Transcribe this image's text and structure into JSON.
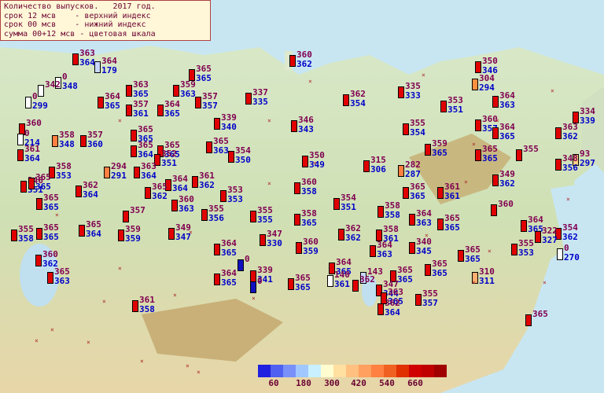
{
  "legend": {
    "lines": [
      "Количество выпусков.   2017 год.",
      "срок 12 мсв    - верхний индекс",
      "срок 00 мсв    - нижний индекс",
      "сумма 00+12 мсв - цветовая шкала"
    ]
  },
  "color_scale": {
    "colors": [
      "#2020e0",
      "#5060f0",
      "#7890f8",
      "#a0c8ff",
      "#c8f0ff",
      "#fffcd0",
      "#ffe0a0",
      "#ffc080",
      "#ffa060",
      "#ff8040",
      "#f06020",
      "#e03000",
      "#d00000",
      "#c00000",
      "#a00000"
    ],
    "ticks": [
      "60",
      "180",
      "300",
      "420",
      "540",
      "660"
    ]
  },
  "stations": [
    {
      "upper": "363",
      "lower": "364",
      "color": "#e00000"
    },
    {
      "upper": "364",
      "lower": "179",
      "color": "#c8d8ff"
    },
    {
      "upper": "365",
      "lower": "365",
      "color": "#e00000"
    },
    {
      "upper": "360",
      "lower": "362",
      "color": "#e00000"
    },
    {
      "upper": "350",
      "lower": "346",
      "color": "#e00000"
    },
    {
      "upper": "304",
      "lower": "294",
      "color": "#ff9040"
    },
    {
      "upper": "0",
      "lower": "348",
      "color": "#ffffff"
    },
    {
      "upper": "342",
      "lower": "",
      "color": "#ffffff"
    },
    {
      "upper": "0",
      "lower": "299",
      "color": "#ffffff"
    },
    {
      "upper": "363",
      "lower": "365",
      "color": "#e00000"
    },
    {
      "upper": "359",
      "lower": "363",
      "color": "#e00000"
    },
    {
      "upper": "337",
      "lower": "335",
      "color": "#e00000"
    },
    {
      "upper": "362",
      "lower": "354",
      "color": "#e00000"
    },
    {
      "upper": "335",
      "lower": "333",
      "color": "#e00000"
    },
    {
      "upper": "353",
      "lower": "351",
      "color": "#e00000"
    },
    {
      "upper": "364",
      "lower": "363",
      "color": "#e00000"
    },
    {
      "upper": "334",
      "lower": "339",
      "color": "#e00000"
    },
    {
      "upper": "364",
      "lower": "365",
      "color": "#e00000"
    },
    {
      "upper": "357",
      "lower": "361",
      "color": "#e00000"
    },
    {
      "upper": "364",
      "lower": "365",
      "color": "#e00000"
    },
    {
      "upper": "357",
      "lower": "357",
      "color": "#e00000"
    },
    {
      "upper": "339",
      "lower": "340",
      "color": "#e00000"
    },
    {
      "upper": "346",
      "lower": "343",
      "color": "#e00000"
    },
    {
      "upper": "355",
      "lower": "354",
      "color": "#e00000"
    },
    {
      "upper": "360",
      "lower": "357",
      "color": "#e00000"
    },
    {
      "upper": "364",
      "lower": "365",
      "color": "#e00000"
    },
    {
      "upper": "363",
      "lower": "362",
      "color": "#e00000"
    },
    {
      "upper": "360",
      "lower": "",
      "color": "#e00000"
    },
    {
      "upper": "0",
      "lower": "214",
      "color": "#ffffff"
    },
    {
      "upper": "358",
      "lower": "348",
      "color": "#ff8040"
    },
    {
      "upper": "357",
      "lower": "360",
      "color": "#e00000"
    },
    {
      "upper": "365",
      "lower": "365",
      "color": "#e00000"
    },
    {
      "upper": "365",
      "lower": "365",
      "color": "#e00000"
    },
    {
      "upper": "365",
      "lower": "363",
      "color": "#e00000"
    },
    {
      "upper": "354",
      "lower": "350",
      "color": "#e00000"
    },
    {
      "upper": "359",
      "lower": "365",
      "color": "#e00000"
    },
    {
      "upper": "365",
      "lower": "365",
      "color": "#e00000"
    },
    {
      "upper": "355",
      "lower": "",
      "color": "#e00000"
    },
    {
      "upper": "93",
      "lower": "297",
      "color": "#ffd080"
    },
    {
      "upper": "361",
      "lower": "364",
      "color": "#e00000"
    },
    {
      "upper": "365",
      "lower": "364",
      "color": "#e00000"
    },
    {
      "upper": "352",
      "lower": "351",
      "color": "#e00000"
    },
    {
      "upper": "350",
      "lower": "349",
      "color": "#e00000"
    },
    {
      "upper": "315",
      "lower": "306",
      "color": "#e00000"
    },
    {
      "upper": "282",
      "lower": "287",
      "color": "#ff8040"
    },
    {
      "upper": "348",
      "lower": "356",
      "color": "#e00000"
    },
    {
      "upper": "358",
      "lower": "353",
      "color": "#e00000"
    },
    {
      "upper": "294",
      "lower": "291",
      "color": "#ff8040"
    },
    {
      "upper": "363",
      "lower": "364",
      "color": "#e00000"
    },
    {
      "upper": "346",
      "lower": "351",
      "color": "#e00000"
    },
    {
      "upper": "365",
      "lower": "365",
      "color": "#e00000"
    },
    {
      "upper": "362",
      "lower": "364",
      "color": "#e00000"
    },
    {
      "upper": "364",
      "lower": "364",
      "color": "#e00000"
    },
    {
      "upper": "361",
      "lower": "362",
      "color": "#e00000"
    },
    {
      "upper": "360",
      "lower": "358",
      "color": "#e00000"
    },
    {
      "upper": "365",
      "lower": "365",
      "color": "#e00000"
    },
    {
      "upper": "361",
      "lower": "361",
      "color": "#e00000"
    },
    {
      "upper": "349",
      "lower": "362",
      "color": "#e00000"
    },
    {
      "upper": "365",
      "lower": "365",
      "color": "#e00000"
    },
    {
      "upper": "365",
      "lower": "362",
      "color": "#e00000"
    },
    {
      "upper": "353",
      "lower": "353",
      "color": "#e00000"
    },
    {
      "upper": "354",
      "lower": "351",
      "color": "#e00000"
    },
    {
      "upper": "358",
      "lower": "358",
      "color": "#e00000"
    },
    {
      "upper": "364",
      "lower": "363",
      "color": "#e00000"
    },
    {
      "upper": "365",
      "lower": "365",
      "color": "#e00000"
    },
    {
      "upper": "360",
      "lower": "",
      "color": "#e00000"
    },
    {
      "upper": "364",
      "lower": "365",
      "color": "#e00000"
    },
    {
      "upper": "357",
      "lower": "",
      "color": "#e00000"
    },
    {
      "upper": "360",
      "lower": "363",
      "color": "#e00000"
    },
    {
      "upper": "355",
      "lower": "356",
      "color": "#e00000"
    },
    {
      "upper": "355",
      "lower": "355",
      "color": "#e00000"
    },
    {
      "upper": "358",
      "lower": "365",
      "color": "#e00000"
    },
    {
      "upper": "354",
      "lower": "362",
      "color": "#e00000"
    },
    {
      "upper": "322",
      "lower": "327",
      "color": "#e00000"
    },
    {
      "upper": "0",
      "lower": "270",
      "color": "#ffffff"
    },
    {
      "upper": "355",
      "lower": "358",
      "color": "#e00000"
    },
    {
      "upper": "365",
      "lower": "365",
      "color": "#e00000"
    },
    {
      "upper": "365",
      "lower": "364",
      "color": "#e00000"
    },
    {
      "upper": "359",
      "lower": "359",
      "color": "#e00000"
    },
    {
      "upper": "349",
      "lower": "347",
      "color": "#e00000"
    },
    {
      "upper": "347",
      "lower": "330",
      "color": "#e00000"
    },
    {
      "upper": "362",
      "lower": "362",
      "color": "#e00000"
    },
    {
      "upper": "358",
      "lower": "361",
      "color": "#e00000"
    },
    {
      "upper": "340",
      "lower": "345",
      "color": "#e00000"
    },
    {
      "upper": "365",
      "lower": "365",
      "color": "#e00000"
    },
    {
      "upper": "355",
      "lower": "353",
      "color": "#e00000"
    },
    {
      "upper": "364",
      "lower": "365",
      "color": "#e00000"
    },
    {
      "upper": "364",
      "lower": "363",
      "color": "#e00000"
    },
    {
      "upper": "0",
      "lower": "",
      "color": "#1010c0"
    },
    {
      "upper": "360",
      "lower": "359",
      "color": "#e00000"
    },
    {
      "upper": "360",
      "lower": "362",
      "color": "#e00000"
    },
    {
      "upper": "365",
      "lower": "365",
      "color": "#e00000"
    },
    {
      "upper": "365",
      "lower": "365",
      "color": "#e00000"
    },
    {
      "upper": "310",
      "lower": "311",
      "color": "#ffb070"
    },
    {
      "upper": "364",
      "lower": "365",
      "color": "#e00000"
    },
    {
      "upper": "339",
      "lower": "341",
      "color": "#e00000"
    },
    {
      "upper": "0",
      "lower": "",
      "color": "#1010c0"
    },
    {
      "upper": "364",
      "lower": "365",
      "color": "#e00000"
    },
    {
      "upper": "365",
      "lower": "363",
      "color": "#e00000"
    },
    {
      "upper": "365",
      "lower": "365",
      "color": "#e00000"
    },
    {
      "upper": "140",
      "lower": "361",
      "color": "#ffffff"
    },
    {
      "upper": "143",
      "lower": "",
      "color": "#c8d8ff"
    },
    {
      "upper": "362",
      "lower": "",
      "color": "#e00000"
    },
    {
      "upper": "347",
      "lower": "344",
      "color": "#e00000"
    },
    {
      "upper": "363",
      "lower": "365",
      "color": "#e00000"
    },
    {
      "upper": "355",
      "lower": "357",
      "color": "#e00000"
    },
    {
      "upper": "361",
      "lower": "358",
      "color": "#e00000"
    },
    {
      "upper": "362",
      "lower": "364",
      "color": "#e00000"
    },
    {
      "upper": "365",
      "lower": "",
      "color": "#e00000"
    }
  ]
}
